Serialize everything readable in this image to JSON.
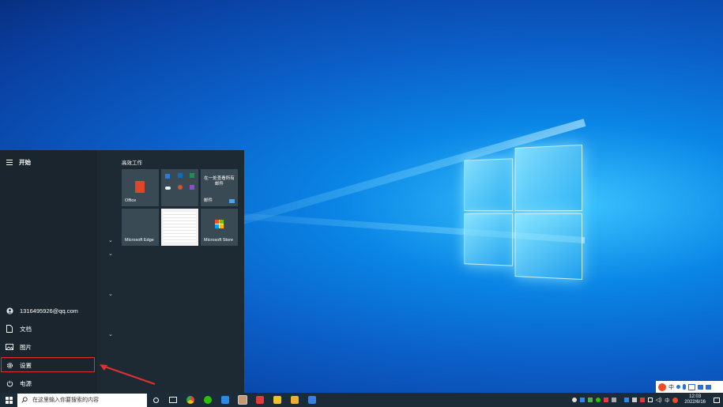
{
  "start_menu": {
    "title": "开始",
    "group_title": "高效工作",
    "user": "1316495926@qq.com",
    "items": [
      {
        "label": "文档",
        "icon": "document-icon"
      },
      {
        "label": "图片",
        "icon": "picture-icon"
      },
      {
        "label": "设置",
        "icon": "gear-icon"
      },
      {
        "label": "电源",
        "icon": "power-icon"
      }
    ],
    "tiles": {
      "office": "Office",
      "mail_text": "在一处查看所有邮件",
      "mail": "邮件",
      "edge": "Microsoft Edge",
      "store": "Microsoft Store"
    }
  },
  "taskbar": {
    "search_placeholder": "在这里输入你要搜索的内容",
    "ime": "中",
    "time": "12:03",
    "date": "2022/6/16"
  },
  "sogou_bar": {
    "label": "中"
  },
  "colors": {
    "accent_red": "#e03030",
    "start_bg": "#1e2a33",
    "taskbar_bg": "#1b2b38"
  }
}
